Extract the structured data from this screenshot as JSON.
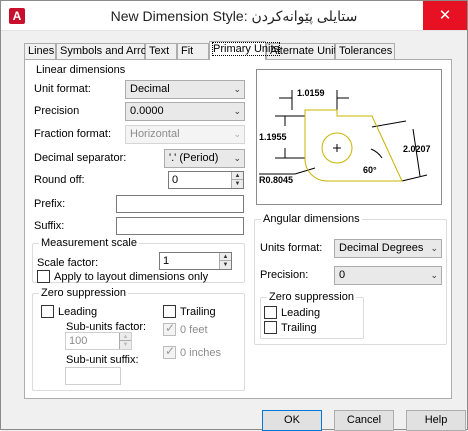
{
  "window": {
    "title": "New Dimension Style: ستایلی پێوانەکردن",
    "close_glyph": "✕",
    "app_icon_glyph": "A"
  },
  "tabs": [
    {
      "label": "Lines"
    },
    {
      "label": "Symbols and Arrows"
    },
    {
      "label": "Text"
    },
    {
      "label": "Fit"
    },
    {
      "label": "Primary Units"
    },
    {
      "label": "Alternate Units"
    },
    {
      "label": "Tolerances"
    }
  ],
  "linear": {
    "group_title": "Linear dimensions",
    "unit_format_label": "Unit format:",
    "unit_format_value": "Decimal",
    "precision_label": "Precision",
    "precision_value": "0.0000",
    "fraction_format_label": "Fraction format:",
    "fraction_format_value": "Horizontal",
    "decimal_separator_label": "Decimal separator:",
    "decimal_separator_value": "'.' (Period)",
    "round_off_label": "Round off:",
    "round_off_value": "0",
    "prefix_label": "Prefix:",
    "prefix_value": "",
    "suffix_label": "Suffix:",
    "suffix_value": ""
  },
  "measurement_scale": {
    "group_title": "Measurement scale",
    "scale_factor_label": "Scale factor:",
    "scale_factor_value": "1",
    "apply_layout_label": "Apply to layout dimensions only"
  },
  "zero_linear": {
    "group_title": "Zero suppression",
    "leading_label": "Leading",
    "trailing_label": "Trailing",
    "subunits_factor_label": "Sub-units factor:",
    "subunits_factor_value": "100",
    "zero_feet_label": "0 feet",
    "zero_inches_label": "0 inches",
    "subunit_suffix_label": "Sub-unit suffix:",
    "subunit_suffix_value": ""
  },
  "preview": {
    "dim_top": "1.0159",
    "dim_left": "1.1955",
    "dim_right": "2.0207",
    "angle": "60°",
    "radius": "R0.8045",
    "center_mark": "+",
    "line_color": "#c8b400"
  },
  "angular": {
    "group_title": "Angular dimensions",
    "units_format_label": "Units format:",
    "units_format_value": "Decimal Degrees",
    "precision_label": "Precision:",
    "precision_value": "0",
    "zero_group_title": "Zero suppression",
    "leading_label": "Leading",
    "trailing_label": "Trailing"
  },
  "buttons": {
    "ok": "OK",
    "cancel": "Cancel",
    "help": "Help"
  }
}
